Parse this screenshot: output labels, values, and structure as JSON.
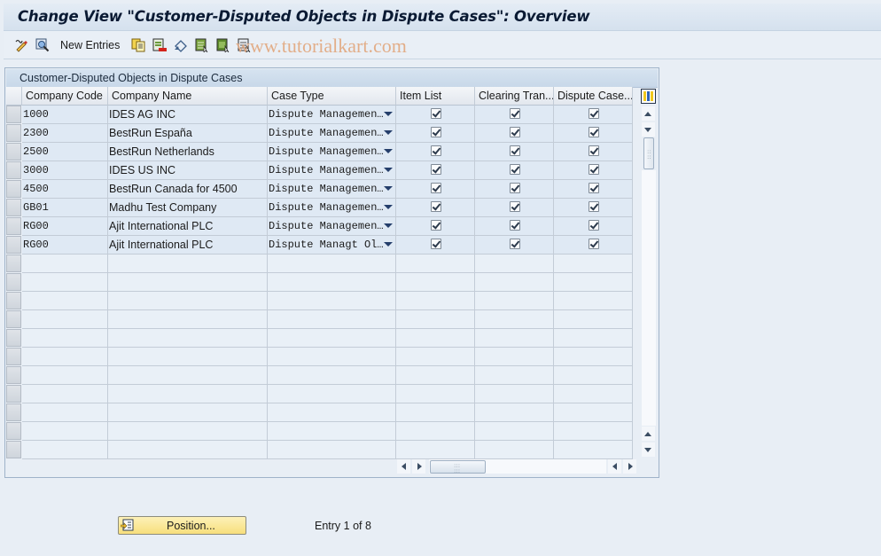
{
  "window": {
    "title": "Change View \"Customer-Disputed Objects in Dispute Cases\": Overview"
  },
  "toolbar": {
    "new_entries_label": "New Entries",
    "icons": [
      "display-change-icon",
      "details-icon",
      "copy-icon",
      "delete-icon",
      "undo-change-icon",
      "select-all-icon",
      "select-block-icon",
      "deselect-all-icon"
    ]
  },
  "watermark": "www.tutorialkart.com",
  "panel": {
    "title": "Customer-Disputed Objects in Dispute Cases"
  },
  "table": {
    "columns": [
      "Company Code",
      "Company Name",
      "Case Type",
      "Item List",
      "Clearing Tran...",
      "Dispute Case..."
    ],
    "rows": [
      {
        "company_code": "1000",
        "company_name": "IDES AG INC",
        "case_type": "Dispute Managemen…",
        "item_list": true,
        "clearing_tran": true,
        "dispute_case": true
      },
      {
        "company_code": "2300",
        "company_name": "BestRun España",
        "case_type": "Dispute Managemen…",
        "item_list": true,
        "clearing_tran": true,
        "dispute_case": true
      },
      {
        "company_code": "2500",
        "company_name": "BestRun Netherlands",
        "case_type": "Dispute Managemen…",
        "item_list": true,
        "clearing_tran": true,
        "dispute_case": true
      },
      {
        "company_code": "3000",
        "company_name": "IDES US INC",
        "case_type": "Dispute Managemen…",
        "item_list": true,
        "clearing_tran": true,
        "dispute_case": true
      },
      {
        "company_code": "4500",
        "company_name": "BestRun Canada for 4500",
        "case_type": "Dispute Managemen…",
        "item_list": true,
        "clearing_tran": true,
        "dispute_case": true
      },
      {
        "company_code": "GB01",
        "company_name": "Madhu Test Company",
        "case_type": "Dispute Managemen…",
        "item_list": true,
        "clearing_tran": true,
        "dispute_case": true
      },
      {
        "company_code": "RG00",
        "company_name": "Ajit International PLC",
        "case_type": "Dispute Managemen…",
        "item_list": true,
        "clearing_tran": true,
        "dispute_case": true
      },
      {
        "company_code": "RG00",
        "company_name": "Ajit International PLC",
        "case_type": "Dispute Managt Ol…",
        "item_list": true,
        "clearing_tran": true,
        "dispute_case": true
      }
    ],
    "empty_rows": 11
  },
  "footer": {
    "position_button_label": "Position...",
    "entry_text": "Entry 1 of 8"
  }
}
